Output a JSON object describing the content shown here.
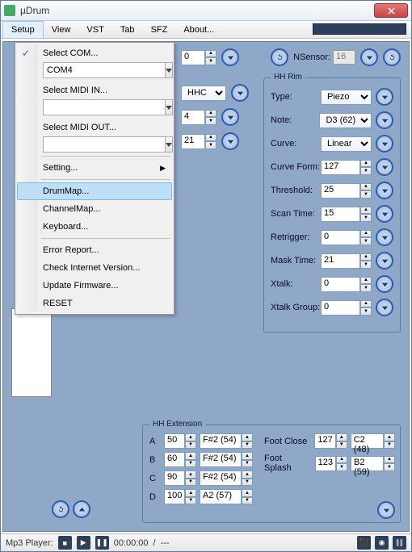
{
  "window": {
    "title": "µDrum"
  },
  "menubar": {
    "items": [
      "Setup",
      "View",
      "VST",
      "Tab",
      "SFZ",
      "About..."
    ],
    "open_index": 0
  },
  "setup_menu": {
    "select_com": "Select COM...",
    "com_value": "COM4",
    "select_midi_in": "Select MIDI IN...",
    "midi_in_value": "",
    "select_midi_out": "Select MIDI OUT...",
    "midi_out_value": "",
    "setting": "Setting...",
    "drummap": "DrumMap...",
    "channelmap": "ChannelMap...",
    "keyboard": "Keyboard...",
    "error_report": "Error Report...",
    "check_internet": "Check Internet Version...",
    "update_firmware": "Update Firmware...",
    "reset": "RESET"
  },
  "top": {
    "nsensor_label": "NSensor:",
    "nsensor_value": "16"
  },
  "partial": {
    "v0": "0",
    "hhc_label": "HHC",
    "v4": "4",
    "v21": "21"
  },
  "hhrim": {
    "title": "HH Rim",
    "rows": [
      {
        "label": "Type:",
        "kind": "select",
        "value": "Piezo"
      },
      {
        "label": "Note:",
        "kind": "select",
        "value": "D3 (62)"
      },
      {
        "label": "Curve:",
        "kind": "select",
        "value": "Linear",
        "wide": true
      },
      {
        "label": "Curve Form:",
        "kind": "spin",
        "value": "127"
      },
      {
        "label": "Threshold:",
        "kind": "spin",
        "value": "25"
      },
      {
        "label": "Scan Time:",
        "kind": "spin",
        "value": "15"
      },
      {
        "label": "Retrigger:",
        "kind": "spin",
        "value": "0"
      },
      {
        "label": "Mask Time:",
        "kind": "spin",
        "value": "21"
      },
      {
        "label": "Xtalk:",
        "kind": "spin",
        "value": "0"
      },
      {
        "label": "Xtalk Group:",
        "kind": "spin",
        "value": "0"
      }
    ]
  },
  "hhext": {
    "title": "HH Extension",
    "rows": [
      {
        "label": "A",
        "v1": "50",
        "v2": "F#2 (54)"
      },
      {
        "label": "B",
        "v1": "60",
        "v2": "F#2 (54)"
      },
      {
        "label": "C",
        "v1": "90",
        "v2": "F#2 (54)"
      },
      {
        "label": "D",
        "v1": "100",
        "v2": "A2 (57)"
      }
    ],
    "foot_close": {
      "label": "Foot Close",
      "v1": "127",
      "v2": "C2 (48)"
    },
    "foot_splash": {
      "label": "Foot Splash",
      "v1": "123",
      "v2": "B2 (59)"
    }
  },
  "statusbar": {
    "label": "Mp3 Player:",
    "time": "00:00:00",
    "sep": "/",
    "dur": "---"
  }
}
